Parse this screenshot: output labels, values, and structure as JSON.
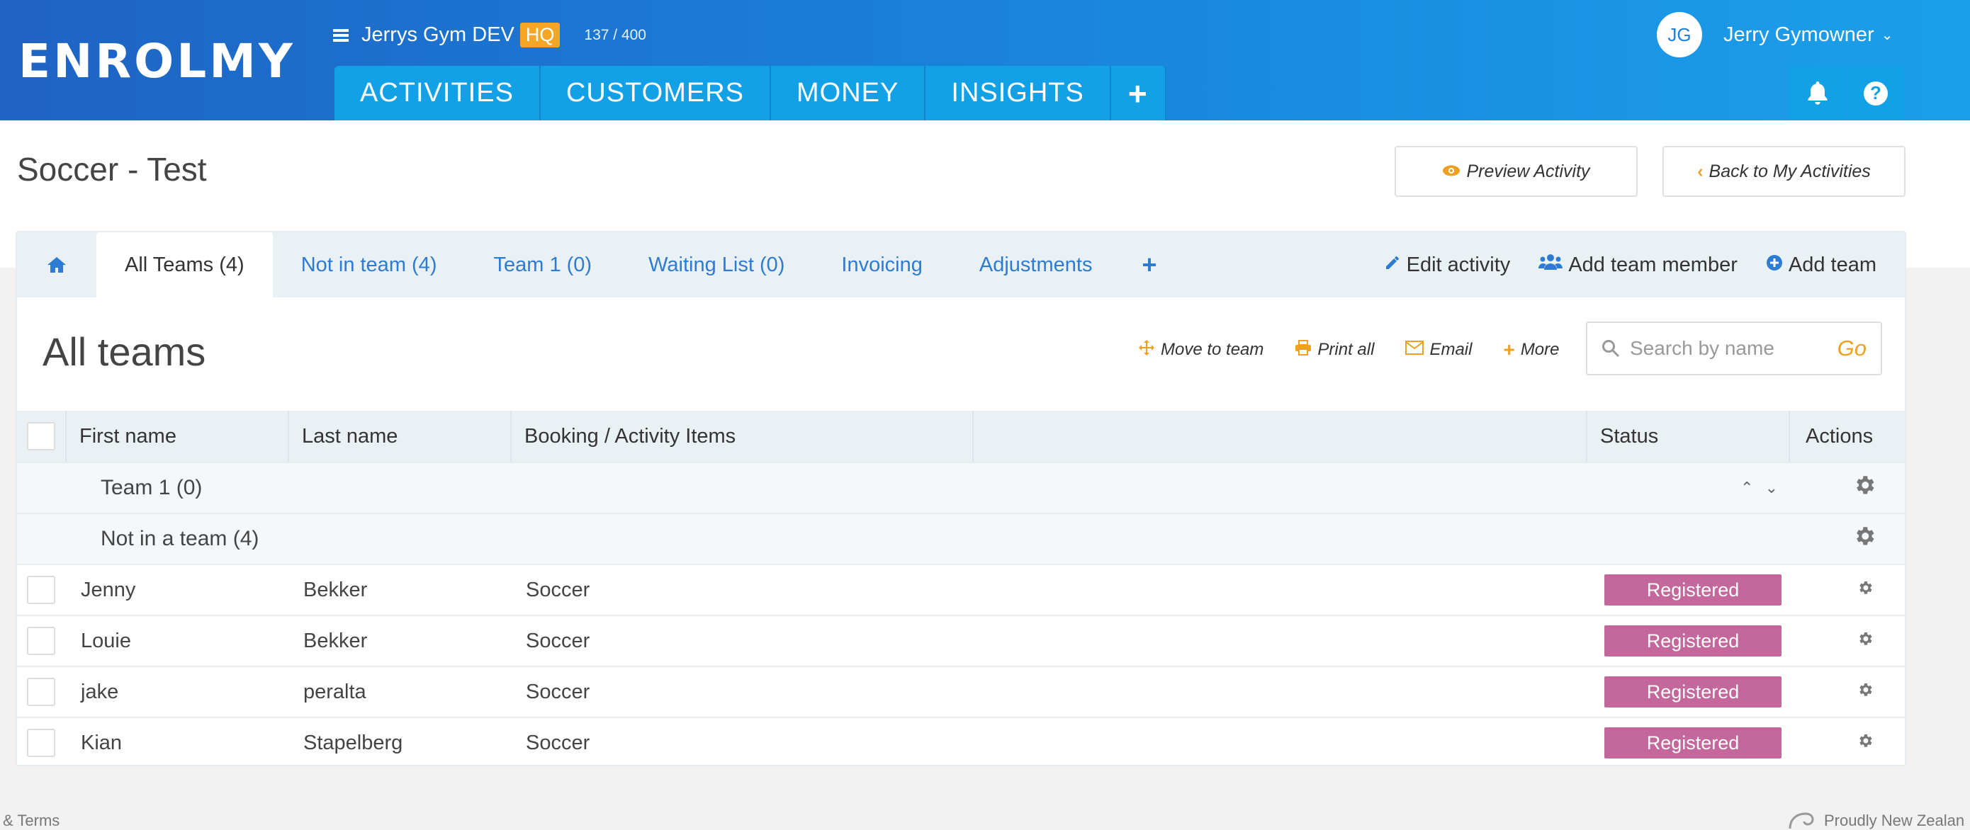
{
  "header": {
    "logo": "ENROLMY",
    "org_name": "Jerrys Gym DEV",
    "org_badge": "HQ",
    "org_count": "137 / 400",
    "nav": [
      "ACTIVITIES",
      "CUSTOMERS",
      "MONEY",
      "INSIGHTS"
    ],
    "nav_plus": "+",
    "user_initials": "JG",
    "user_name": "Jerry Gymowner"
  },
  "page": {
    "title": "Soccer - Test",
    "preview_button": "Preview Activity",
    "back_button": "Back to My Activities"
  },
  "tabs": {
    "items": [
      "All Teams (4)",
      "Not in team (4)",
      "Team 1 (0)",
      "Waiting List (0)",
      "Invoicing",
      "Adjustments"
    ],
    "plus": "+",
    "actions": [
      "Edit activity",
      "Add team member",
      "Add team"
    ]
  },
  "section": {
    "title": "All teams",
    "tools": [
      "Move to team",
      "Print all",
      "Email",
      "More"
    ],
    "search_placeholder": "Search by name",
    "search_go": "Go"
  },
  "table": {
    "columns": [
      "First name",
      "Last name",
      "Booking / Activity Items",
      "",
      "Status",
      "Actions"
    ],
    "groups": [
      {
        "label": "Team 1  (0)"
      },
      {
        "label": "Not in a team  (4)"
      }
    ],
    "rows": [
      {
        "first": "Jenny",
        "last": "Bekker",
        "booking": "Soccer",
        "status": "Registered"
      },
      {
        "first": "Louie",
        "last": "Bekker",
        "booking": "Soccer",
        "status": "Registered"
      },
      {
        "first": "jake",
        "last": "peralta",
        "booking": "Soccer",
        "status": "Registered"
      },
      {
        "first": "Kian",
        "last": "Stapelberg",
        "booking": "Soccer",
        "status": "Registered"
      }
    ]
  },
  "footer": {
    "left": "& Terms",
    "right": "Proudly New Zealan"
  },
  "colors": {
    "accent": "#1a7fd8",
    "nav": "#12a0e6",
    "orange": "#f0a020",
    "status": "#c3679c"
  }
}
